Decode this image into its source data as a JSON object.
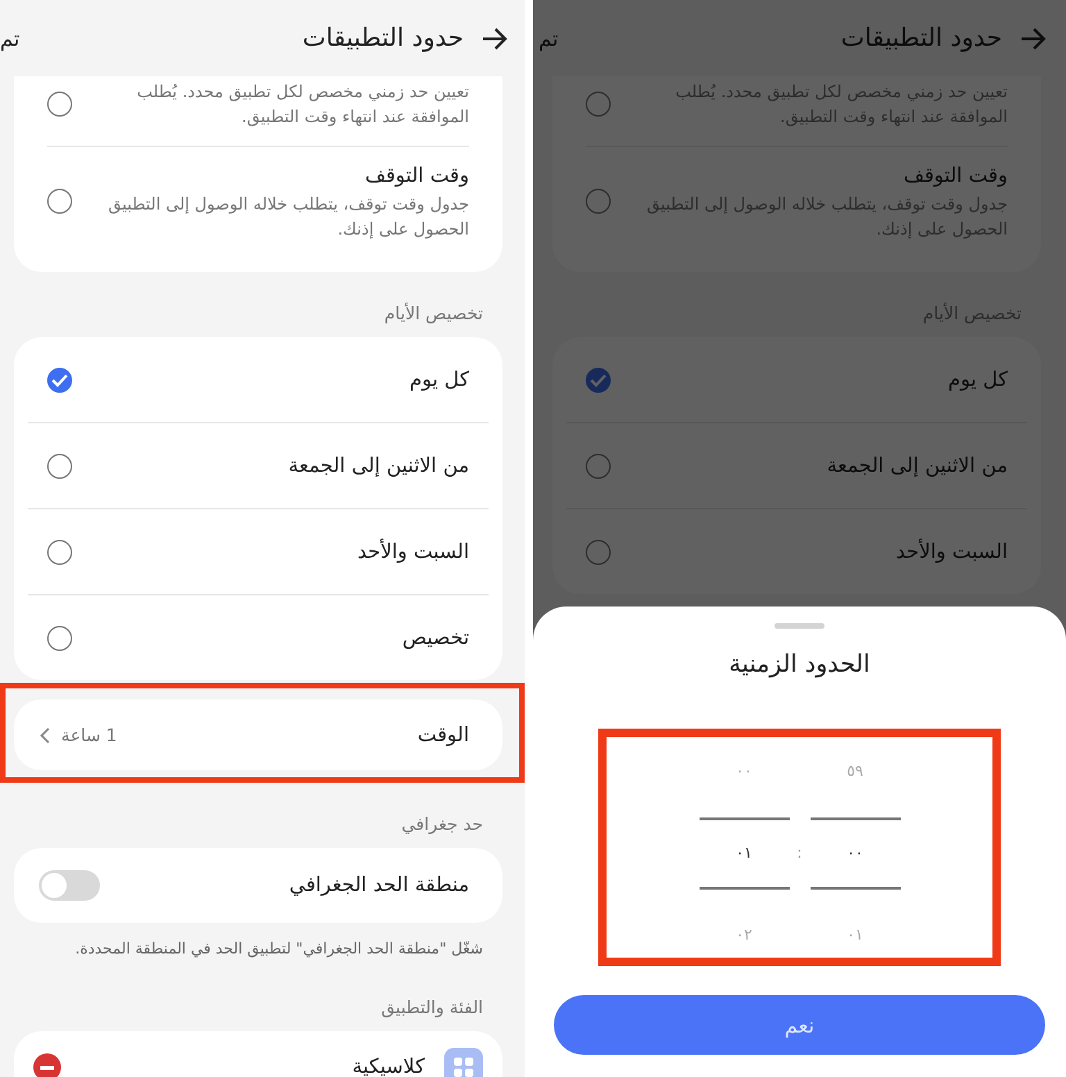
{
  "screens": [
    {
      "dimmed": true,
      "header": {
        "title": "حدود التطبيقات",
        "action": "تم"
      },
      "limit_types": [
        {
          "description": "تعيين حد زمني مخصص لكل تطبيق محدد. يُطلب الموافقة عند انتهاء وقت التطبيق.",
          "selected": false
        },
        {
          "title": "وقت التوقف",
          "description": "جدول وقت توقف، يتطلب خلاله الوصول إلى التطبيق الحصول على إذنك.",
          "selected": false
        }
      ],
      "days_heading": "تخصيص الأيام",
      "days": [
        {
          "label": "كل يوم",
          "selected": true
        },
        {
          "label": "من الاثنين إلى الجمعة",
          "selected": false
        },
        {
          "label": "السبت والأحد",
          "selected": false
        }
      ],
      "sheet": {
        "title": "الحدود الزمنية",
        "picker": {
          "highlighted": true,
          "separator": ":",
          "columns": [
            {
              "items": [
                {
                  "text": "٥٩",
                  "selected": false
                },
                {
                  "text": "٠٠",
                  "selected": true
                },
                {
                  "text": "٠١",
                  "selected": false
                }
              ]
            },
            {
              "items": [
                {
                  "text": "٠٠",
                  "selected": false
                },
                {
                  "text": "٠١",
                  "selected": true
                },
                {
                  "text": "٠٢",
                  "selected": false
                }
              ]
            }
          ]
        },
        "button": "نعم"
      }
    },
    {
      "header": {
        "title": "حدود التطبيقات",
        "action": "تم"
      },
      "limit_types": [
        {
          "description": "تعيين حد زمني مخصص لكل تطبيق محدد. يُطلب الموافقة عند انتهاء وقت التطبيق.",
          "selected": false
        },
        {
          "title": "وقت التوقف",
          "description": "جدول وقت توقف، يتطلب خلاله الوصول إلى التطبيق الحصول على إذنك.",
          "selected": false
        }
      ],
      "days_heading": "تخصيص الأيام",
      "days": [
        {
          "label": "كل يوم",
          "selected": true
        },
        {
          "label": "من الاثنين إلى الجمعة",
          "selected": false
        },
        {
          "label": "السبت والأحد",
          "selected": false
        },
        {
          "label": "تخصيص",
          "selected": false
        }
      ],
      "time_row": {
        "label": "الوقت",
        "value": "1 ساعة",
        "highlighted": true
      },
      "geo_heading": "حد جغرافي",
      "geo_toggle": {
        "label": "منطقة الحد الجغرافي",
        "on": false
      },
      "geo_hint": "شغّل \"منطقة الحد الجغرافي\" لتطبيق الحد في المنطقة المحددة.",
      "category_heading": "الفئة والتطبيق",
      "categories": [
        {
          "name": "كلاسيكية"
        }
      ]
    }
  ]
}
